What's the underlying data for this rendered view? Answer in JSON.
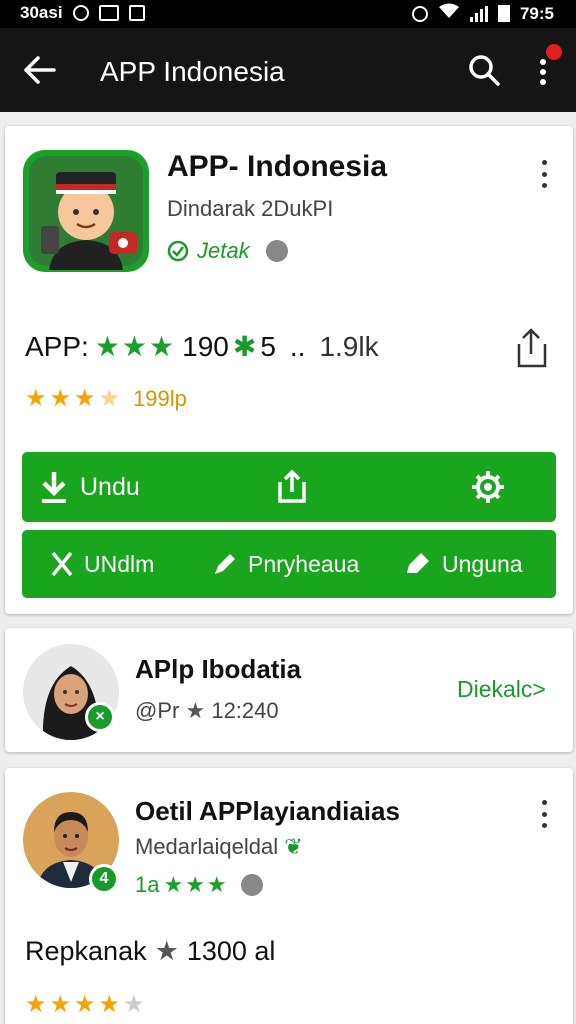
{
  "status_bar": {
    "left_text": "30asi",
    "time": "79:5"
  },
  "appbar": {
    "title": "APP Indonesia"
  },
  "app_card": {
    "title": "APP- Indonesia",
    "developer": "Dindarak 2DukPI",
    "verified_label": "Jetak",
    "rating_prefix": "APP:",
    "rating_stars": "★★★",
    "rating_value": "190",
    "rating_extra": "5",
    "separator": "..",
    "downloads": "1.9lk",
    "sub_stars": "★★★",
    "sub_half": "★",
    "sub_value": "199lp",
    "buttons_primary": {
      "download": "Undu"
    },
    "buttons_secondary": {
      "install": "UNdlm",
      "review": "Pnryheaua",
      "use": "Unguna"
    },
    "accent_color": "#1aa51f"
  },
  "profile_card": {
    "name": "APlp Ibodatia",
    "handle": "@Pr",
    "star": "★",
    "time": "12:240",
    "follow_label": "Diekalc",
    "badge": "×"
  },
  "review_card": {
    "name": "Oetil APPlayiandiaias",
    "subtitle": "Medarlaiqeldal",
    "meta_prefix": "1a",
    "meta_stars": "★★★",
    "badge": "4",
    "review_label": "Repkanak",
    "review_star": "★",
    "review_value": "1300 al",
    "bottom_stars": "★★★★",
    "bottom_dim_star": "★"
  }
}
